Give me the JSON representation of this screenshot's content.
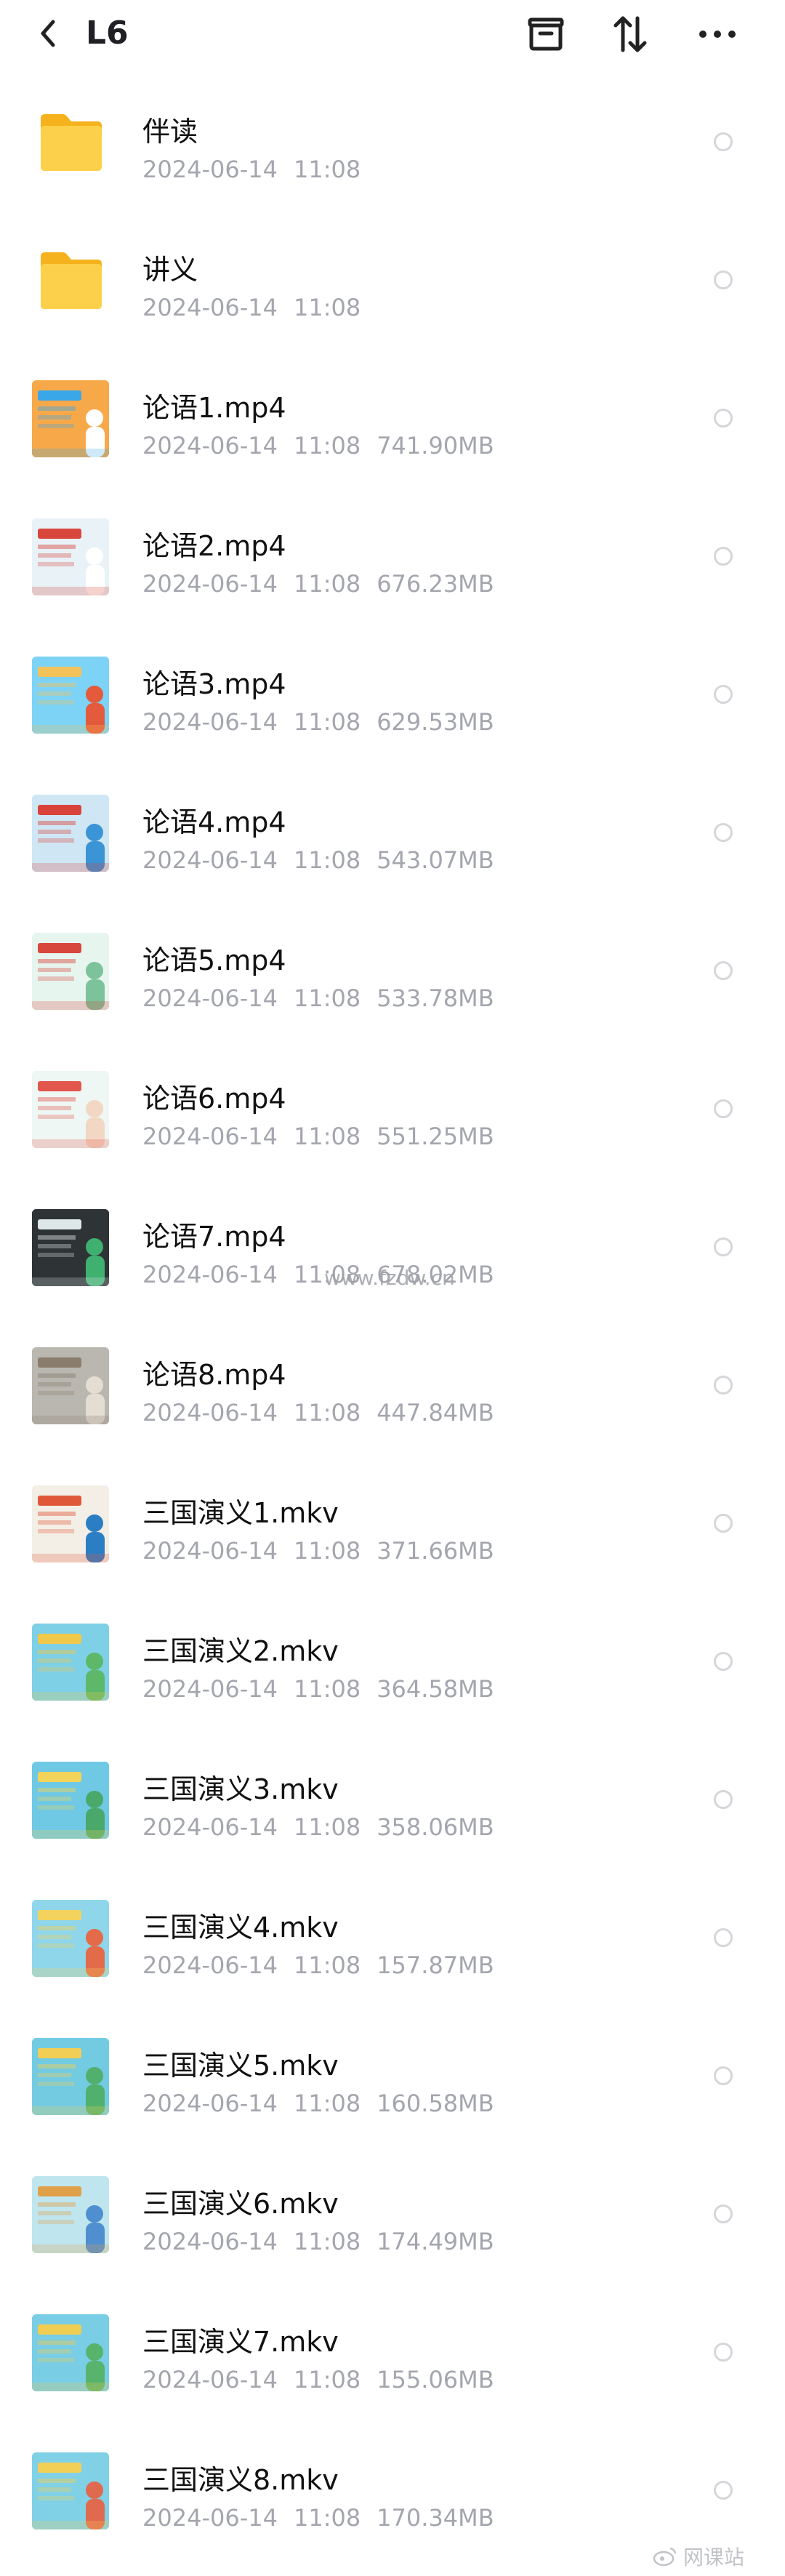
{
  "header": {
    "title": "L6",
    "back_icon": "chevron-left-icon",
    "icons": [
      "archive-box-icon",
      "sort-arrows-icon",
      "more-dots-icon"
    ]
  },
  "items": [
    {
      "name": "伴读",
      "date": "2024-06-14",
      "time": "11:08",
      "size": "",
      "kind": "folder"
    },
    {
      "name": "讲义",
      "date": "2024-06-14",
      "time": "11:08",
      "size": "",
      "kind": "folder"
    },
    {
      "name": "论语1.mp4",
      "date": "2024-06-14",
      "time": "11:08",
      "size": "741.90MB",
      "kind": "video",
      "colors": [
        "#f7a94a",
        "#3aa7e8",
        "#ffffff"
      ]
    },
    {
      "name": "论语2.mp4",
      "date": "2024-06-14",
      "time": "11:08",
      "size": "676.23MB",
      "kind": "video",
      "colors": [
        "#e9f2f7",
        "#d8473c",
        "#ffffff"
      ]
    },
    {
      "name": "论语3.mp4",
      "date": "2024-06-14",
      "time": "11:08",
      "size": "629.53MB",
      "kind": "video",
      "colors": [
        "#7dd3f5",
        "#f3c25a",
        "#e45a3c"
      ]
    },
    {
      "name": "论语4.mp4",
      "date": "2024-06-14",
      "time": "11:08",
      "size": "543.07MB",
      "kind": "video",
      "colors": [
        "#cfe7f4",
        "#d9433c",
        "#3b94d6"
      ]
    },
    {
      "name": "论语5.mp4",
      "date": "2024-06-14",
      "time": "11:08",
      "size": "533.78MB",
      "kind": "video",
      "colors": [
        "#e7f5ef",
        "#d8473c",
        "#7cc39b"
      ]
    },
    {
      "name": "论语6.mp4",
      "date": "2024-06-14",
      "time": "11:08",
      "size": "551.25MB",
      "kind": "video",
      "colors": [
        "#eef7f4",
        "#e2574c",
        "#f2d7c4"
      ]
    },
    {
      "name": "论语7.mp4",
      "date": "2024-06-14",
      "time": "11:08",
      "size": "678.02MB",
      "kind": "video",
      "colors": [
        "#2e3336",
        "#dfe8e9",
        "#3fb070"
      ]
    },
    {
      "name": "论语8.mp4",
      "date": "2024-06-14",
      "time": "11:08",
      "size": "447.84MB",
      "kind": "video",
      "colors": [
        "#b9b7b0",
        "#8a7d6e",
        "#e3ddd2"
      ]
    },
    {
      "name": "三国演义1.mkv",
      "date": "2024-06-14",
      "time": "11:08",
      "size": "371.66MB",
      "kind": "video",
      "colors": [
        "#f4efe6",
        "#e0583a",
        "#2c7ec4"
      ]
    },
    {
      "name": "三国演义2.mkv",
      "date": "2024-06-14",
      "time": "11:08",
      "size": "364.58MB",
      "kind": "video",
      "colors": [
        "#7ed0e6",
        "#f0c84a",
        "#5db86a"
      ]
    },
    {
      "name": "三国演义3.mkv",
      "date": "2024-06-14",
      "time": "11:08",
      "size": "358.06MB",
      "kind": "video",
      "colors": [
        "#6fc9e4",
        "#f2d45a",
        "#4aa86a"
      ]
    },
    {
      "name": "三国演义4.mkv",
      "date": "2024-06-14",
      "time": "11:08",
      "size": "157.87MB",
      "kind": "video",
      "colors": [
        "#8fd6ea",
        "#f3d25e",
        "#e36b4a"
      ]
    },
    {
      "name": "三国演义5.mkv",
      "date": "2024-06-14",
      "time": "11:08",
      "size": "160.58MB",
      "kind": "video",
      "colors": [
        "#73cbe2",
        "#f1cf55",
        "#52b06e"
      ]
    },
    {
      "name": "三国演义6.mkv",
      "date": "2024-06-14",
      "time": "11:08",
      "size": "174.49MB",
      "kind": "video",
      "colors": [
        "#bfe6ef",
        "#e0a04a",
        "#4f8fd0"
      ]
    },
    {
      "name": "三国演义7.mkv",
      "date": "2024-06-14",
      "time": "11:08",
      "size": "155.06MB",
      "kind": "video",
      "colors": [
        "#79cde4",
        "#f0cd53",
        "#58b46c"
      ]
    },
    {
      "name": "三国演义8.mkv",
      "date": "2024-06-14",
      "time": "11:08",
      "size": "170.34MB",
      "kind": "video",
      "colors": [
        "#80d1e6",
        "#f2cf57",
        "#e06a4f"
      ]
    }
  ],
  "watermarks": {
    "center": "www.fzdw.cn",
    "corner": "网课站"
  }
}
